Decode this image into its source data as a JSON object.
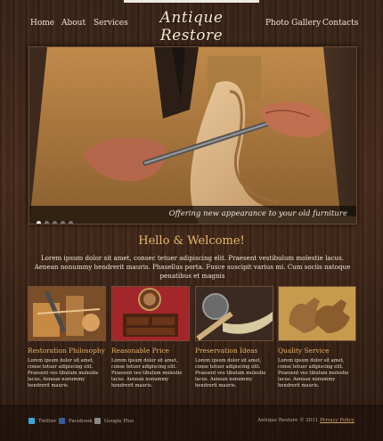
{
  "nav": {
    "home": "Home",
    "about": "About",
    "services": "Services",
    "logo": "Antique Restore",
    "gallery": "Photo Gallery",
    "contacts": "Contacts"
  },
  "hero": {
    "tagline": "Offering new appearance to your old furniture",
    "slides_total": 5,
    "active_slide": 1
  },
  "welcome": {
    "title": "Hello & Welcome!",
    "text": "Lorem ipsum dolor sit amet, consec tetuer adipiscing elit. Praesent vestibulum molestie lacus. Aenean nonummy hendrerit mauris. Phasellus porta. Fusce suscipit varius mi. Cum sociis natoque penatibus et magnis"
  },
  "cards": [
    {
      "title": "Restoration Philosophy",
      "text": "Lorem ipsum dolor sit amet, conse tetuer adipiscing elit. Praesent ves tibulum molestie lacus. Aenean nonummy hendrerit mauris."
    },
    {
      "title": "Reasonable Price",
      "text": "Lorem ipsum dolor sit amet, conse tetuer adipiscing elit. Praesent ves tibulum molestie lacus. Aenean nonummy hendrerit mauris."
    },
    {
      "title": "Preservation Ideas",
      "text": "Lorem ipsum dolor sit amet, conse tetuer adipiscing elit. Praesent ves tibulum molestie lacus. Aenean nonummy hendrerit mauris."
    },
    {
      "title": "Quality Service",
      "text": "Lorem ipsum dolor sit amet, conse tetuer adipiscing elit. Praesent ves tibulum molestie lacus. Aenean nonummy hendrerit mauris."
    }
  ],
  "footer": {
    "twitter": "Twitter",
    "facebook": "Facebook",
    "google": "Google Plus",
    "copyright": "Antique Restore © 2011",
    "privacy": "Privacy Policy"
  },
  "colors": {
    "accent": "#e9b96a",
    "text": "#f0e6d6"
  },
  "icons": [
    "twitter-icon",
    "facebook-icon",
    "google-plus-icon"
  ]
}
